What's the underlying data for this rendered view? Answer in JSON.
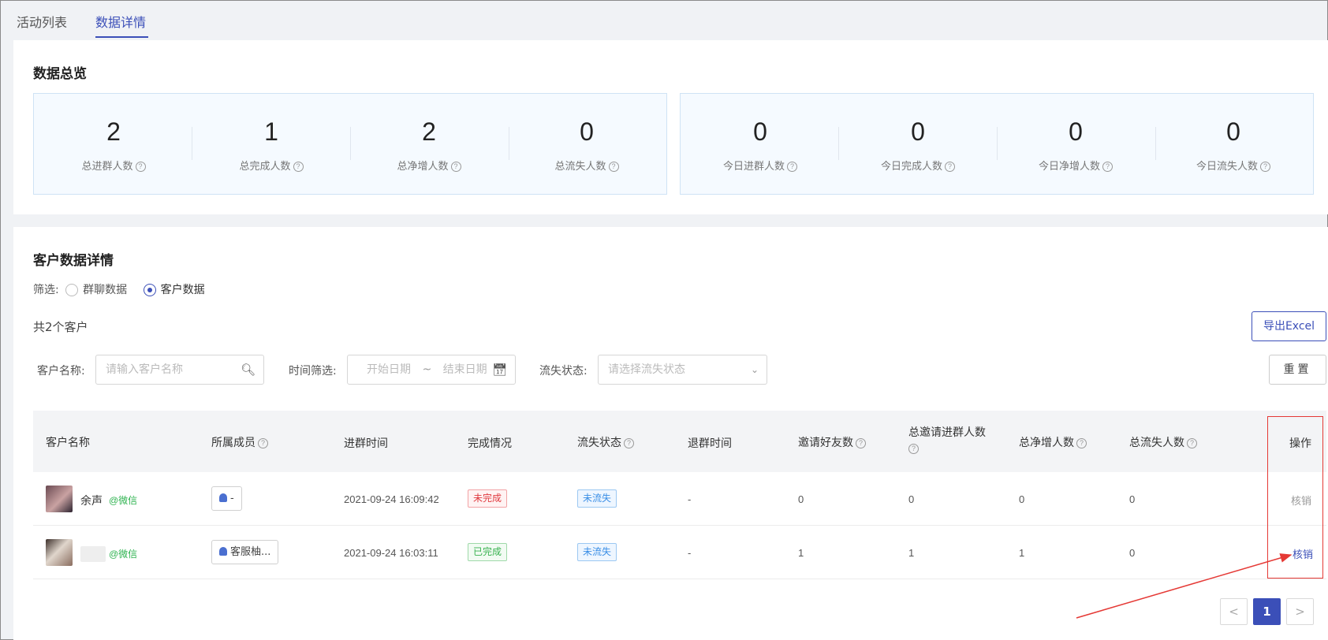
{
  "tabs": [
    {
      "label": "活动列表",
      "active": false
    },
    {
      "label": "数据详情",
      "active": true
    }
  ],
  "overview": {
    "title": "数据总览",
    "total": [
      {
        "value": "2",
        "label": "总进群人数"
      },
      {
        "value": "1",
        "label": "总完成人数"
      },
      {
        "value": "2",
        "label": "总净增人数"
      },
      {
        "value": "0",
        "label": "总流失人数"
      }
    ],
    "today": [
      {
        "value": "0",
        "label": "今日进群人数"
      },
      {
        "value": "0",
        "label": "今日完成人数"
      },
      {
        "value": "0",
        "label": "今日净增人数"
      },
      {
        "value": "0",
        "label": "今日流失人数"
      }
    ]
  },
  "details": {
    "title": "客户数据详情",
    "filter_label": "筛选:",
    "filter_options": [
      "群聊数据",
      "客户数据"
    ],
    "selected_filter": "客户数据",
    "count_text": "共2个客户",
    "export_label": "导出Excel",
    "reset_label": "重置",
    "search": {
      "name_label": "客户名称:",
      "name_placeholder": "请输入客户名称",
      "time_label": "时间筛选:",
      "start_placeholder": "开始日期",
      "range_sep": "~",
      "end_placeholder": "结束日期",
      "status_label": "流失状态:",
      "status_placeholder": "请选择流失状态"
    },
    "columns": [
      "客户名称",
      "所属成员",
      "进群时间",
      "完成情况",
      "流失状态",
      "退群时间",
      "邀请好友数",
      "总邀请进群人数",
      "总净增人数",
      "总流失人数",
      "操作"
    ],
    "rows": [
      {
        "name": "余声",
        "source": "@微信",
        "member": "-",
        "join_time": "2021-09-24 16:09:42",
        "completion": "未完成",
        "loss_status": "未流失",
        "leave_time": "-",
        "invites": "0",
        "total_invited": "0",
        "net_added": "0",
        "lost": "0",
        "action": "核销"
      },
      {
        "name": "",
        "source": "@微信",
        "member": "客服柚...",
        "join_time": "2021-09-24 16:03:11",
        "completion": "已完成",
        "loss_status": "未流失",
        "leave_time": "-",
        "invites": "1",
        "total_invited": "1",
        "net_added": "1",
        "lost": "0",
        "action": "核销"
      }
    ]
  },
  "pagination": {
    "current": "1",
    "prev": "<",
    "next": ">"
  },
  "colors": {
    "accent": "#3b4fb8",
    "annotation": "#e53935"
  }
}
